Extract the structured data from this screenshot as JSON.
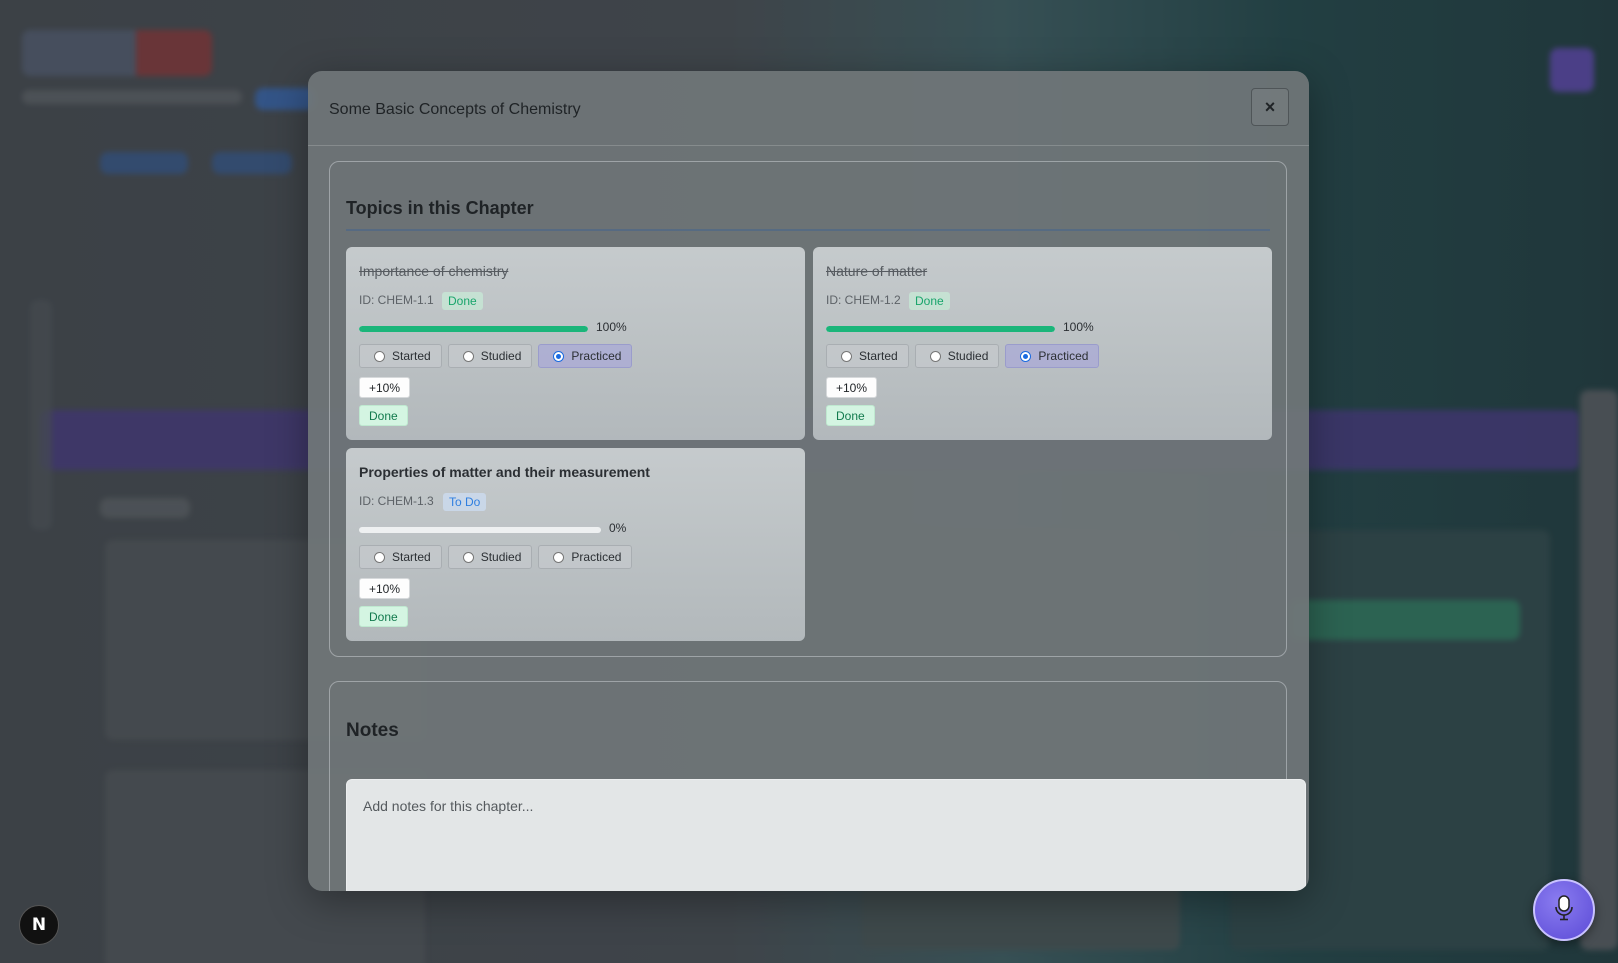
{
  "modal": {
    "title": "Some Basic Concepts of Chemistry",
    "close_label": "×"
  },
  "topics_section": {
    "title": "Topics in this Chapter",
    "topics": [
      {
        "name": "Importance of chemistry",
        "id_label": "ID: CHEM-1.1",
        "status": "Done",
        "progress_pct": 100,
        "progress_label": "100%",
        "options": [
          "Started",
          "Studied",
          "Practiced"
        ],
        "selected_option": "Practiced",
        "increment_label": "+10%",
        "done_label": "Done",
        "completed": true
      },
      {
        "name": "Nature of matter",
        "id_label": "ID: CHEM-1.2",
        "status": "Done",
        "progress_pct": 100,
        "progress_label": "100%",
        "options": [
          "Started",
          "Studied",
          "Practiced"
        ],
        "selected_option": "Practiced",
        "increment_label": "+10%",
        "done_label": "Done",
        "completed": true
      },
      {
        "name": "Properties of matter and their measurement",
        "id_label": "ID: CHEM-1.3",
        "status": "To Do",
        "progress_pct": 0,
        "progress_label": "0%",
        "options": [
          "Started",
          "Studied",
          "Practiced"
        ],
        "selected_option": "",
        "increment_label": "+10%",
        "done_label": "Done",
        "completed": false
      }
    ]
  },
  "notes_section": {
    "title": "Notes",
    "placeholder": "Add notes for this chapter...",
    "value": ""
  },
  "badges": {
    "next_label": "N"
  },
  "icons": {
    "close": "close-icon",
    "mic": "microphone-icon"
  },
  "colors": {
    "progress_fill": "#1bb57a",
    "done_badge": "#19a56b",
    "todo_badge": "#2f7fe0",
    "selected_radio": "#1a6be0",
    "mic_button": "#6a5ae0"
  }
}
